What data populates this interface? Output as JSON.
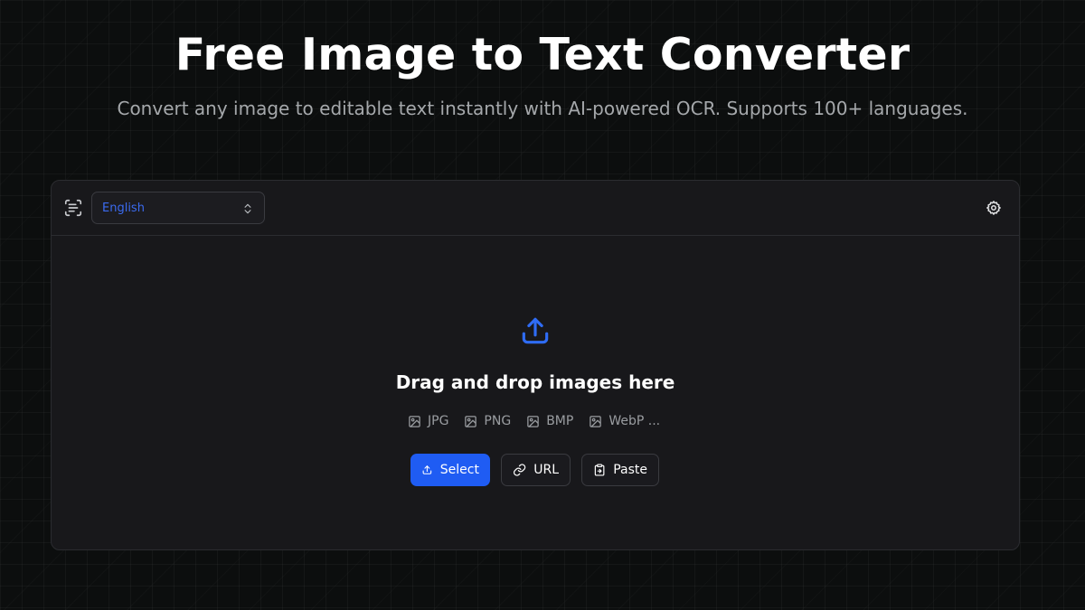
{
  "hero": {
    "title": "Free Image to Text Converter",
    "subtitle": "Convert any image to editable text instantly with AI-powered OCR. Supports 100+ languages."
  },
  "toolbar": {
    "ocr_icon": "scan-text-icon",
    "language": "English",
    "settings_icon": "gear-icon"
  },
  "dropzone": {
    "icon": "upload-icon",
    "title": "Drag and drop images here",
    "formats": [
      "JPG",
      "PNG",
      "BMP",
      "WebP ..."
    ]
  },
  "actions": {
    "select_label": "Select",
    "url_label": "URL",
    "paste_label": "Paste"
  },
  "colors": {
    "accent": "#1f5cf3",
    "background": "#0c0e0e",
    "panel": "#18181b"
  }
}
